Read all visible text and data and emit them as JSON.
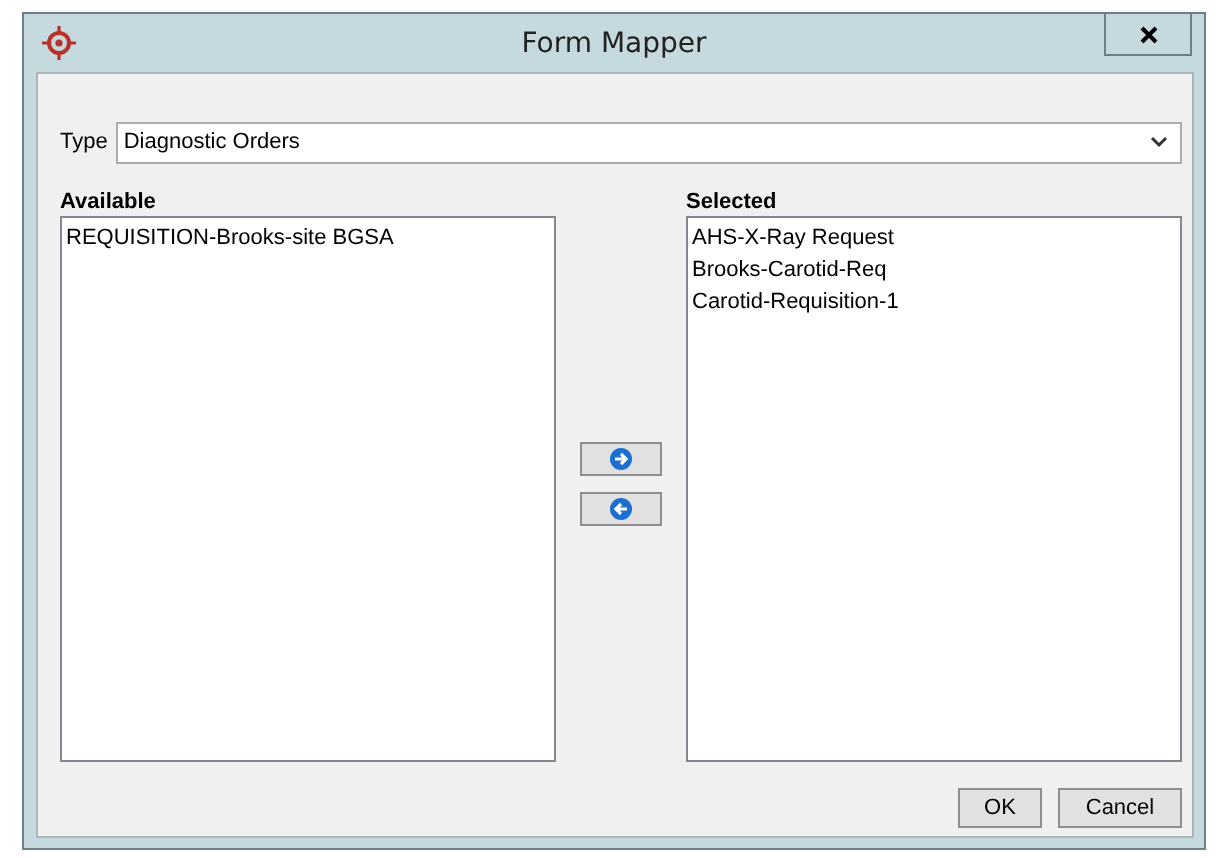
{
  "window": {
    "title": "Form Mapper"
  },
  "type_field": {
    "label": "Type",
    "value": "Diagnostic Orders"
  },
  "available": {
    "label": "Available",
    "items": [
      "REQUISITION-Brooks-site BGSA"
    ]
  },
  "selected": {
    "label": "Selected",
    "items": [
      "AHS-X-Ray Request",
      "Brooks-Carotid-Req",
      "Carotid-Requisition-1"
    ]
  },
  "buttons": [
    "OK",
    "Cancel"
  ]
}
